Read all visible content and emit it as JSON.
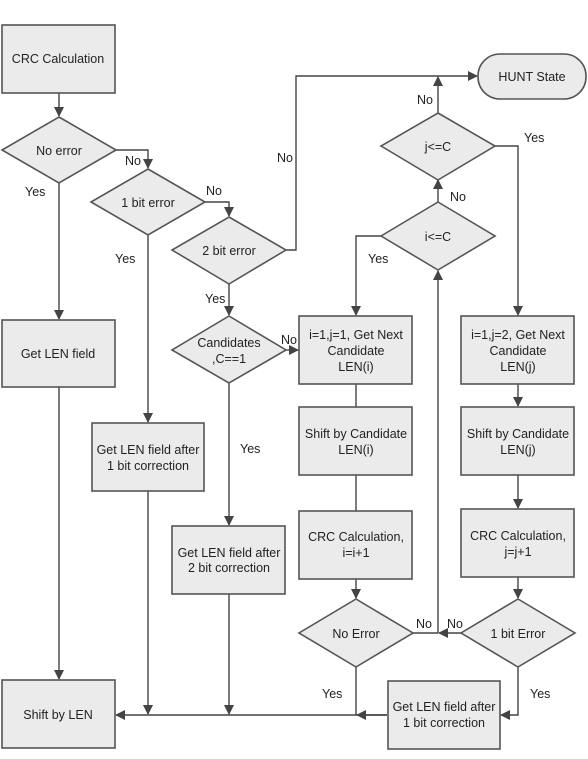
{
  "diagram": {
    "type": "flowchart",
    "nodes": {
      "crc_calc": {
        "shape": "process",
        "lines": [
          "CRC Calculation"
        ]
      },
      "no_error": {
        "shape": "decision",
        "lines": [
          "No error"
        ]
      },
      "one_bit_error": {
        "shape": "decision",
        "lines": [
          "1 bit error"
        ]
      },
      "two_bit_error": {
        "shape": "decision",
        "lines": [
          "2 bit error"
        ]
      },
      "candidates": {
        "shape": "decision",
        "lines": [
          "Candidates",
          ",C==1"
        ]
      },
      "get_len": {
        "shape": "process",
        "lines": [
          "Get LEN field"
        ]
      },
      "get_len_1bit": {
        "shape": "process",
        "lines": [
          "Get LEN field after",
          "1 bit correction"
        ]
      },
      "get_len_2bit": {
        "shape": "process",
        "lines": [
          "Get LEN field after",
          "2 bit correction"
        ]
      },
      "shift_by_len": {
        "shape": "process",
        "lines": [
          "Shift by LEN"
        ]
      },
      "hunt_state": {
        "shape": "terminal",
        "lines": [
          "HUNT State"
        ]
      },
      "j_le_c": {
        "shape": "decision",
        "lines": [
          "j<=C"
        ]
      },
      "i_le_c": {
        "shape": "decision",
        "lines": [
          "i<=C"
        ]
      },
      "init_i": {
        "shape": "process",
        "lines": [
          "i=1,j=1, Get Next",
          "Candidate",
          "LEN(i)"
        ]
      },
      "shift_cand_i": {
        "shape": "process",
        "lines": [
          "Shift by Candidate",
          "LEN(i)"
        ]
      },
      "crc_calc_i": {
        "shape": "process",
        "lines": [
          "CRC Calculation,",
          "i=i+1"
        ]
      },
      "no_error_i": {
        "shape": "decision",
        "lines": [
          "No Error"
        ]
      },
      "init_j": {
        "shape": "process",
        "lines": [
          "i=1,j=2, Get Next",
          "Candidate",
          "LEN(j)"
        ]
      },
      "shift_cand_j": {
        "shape": "process",
        "lines": [
          "Shift by Candidate",
          "LEN(j)"
        ]
      },
      "crc_calc_j": {
        "shape": "process",
        "lines": [
          "CRC Calculation,",
          "j=j+1"
        ]
      },
      "one_bit_error_j": {
        "shape": "decision",
        "lines": [
          "1 bit Error"
        ]
      },
      "get_len_1bit_j": {
        "shape": "process",
        "lines": [
          "Get LEN field after",
          "1 bit correction"
        ]
      }
    },
    "edges": [
      {
        "from": "crc_calc",
        "to": "no_error",
        "label": ""
      },
      {
        "from": "no_error",
        "to": "get_len",
        "label": "Yes"
      },
      {
        "from": "no_error",
        "to": "one_bit_error",
        "label": "No"
      },
      {
        "from": "one_bit_error",
        "to": "get_len_1bit",
        "label": "Yes"
      },
      {
        "from": "one_bit_error",
        "to": "two_bit_error",
        "label": "No"
      },
      {
        "from": "two_bit_error",
        "to": "hunt_state",
        "label": "No"
      },
      {
        "from": "two_bit_error",
        "to": "candidates",
        "label": "Yes"
      },
      {
        "from": "candidates",
        "to": "get_len_2bit",
        "label": "Yes"
      },
      {
        "from": "candidates",
        "to": "init_i",
        "label": "No"
      },
      {
        "from": "get_len",
        "to": "shift_by_len",
        "label": ""
      },
      {
        "from": "get_len_1bit",
        "to": "shift_by_len",
        "label": ""
      },
      {
        "from": "get_len_2bit",
        "to": "shift_by_len",
        "label": ""
      },
      {
        "from": "init_i",
        "to": "shift_cand_i",
        "label": ""
      },
      {
        "from": "shift_cand_i",
        "to": "crc_calc_i",
        "label": ""
      },
      {
        "from": "crc_calc_i",
        "to": "no_error_i",
        "label": ""
      },
      {
        "from": "no_error_i",
        "to": "shift_by_len",
        "label": "Yes"
      },
      {
        "from": "no_error_i",
        "to": "i_le_c",
        "label": "No"
      },
      {
        "from": "i_le_c",
        "to": "init_i",
        "label": "Yes"
      },
      {
        "from": "i_le_c",
        "to": "j_le_c",
        "label": "No"
      },
      {
        "from": "j_le_c",
        "to": "hunt_state",
        "label": "No"
      },
      {
        "from": "j_le_c",
        "to": "init_j",
        "label": "Yes"
      },
      {
        "from": "init_j",
        "to": "shift_cand_j",
        "label": ""
      },
      {
        "from": "shift_cand_j",
        "to": "crc_calc_j",
        "label": ""
      },
      {
        "from": "crc_calc_j",
        "to": "one_bit_error_j",
        "label": ""
      },
      {
        "from": "one_bit_error_j",
        "to": "get_len_1bit_j",
        "label": "Yes"
      },
      {
        "from": "one_bit_error_j",
        "to": "i_le_c",
        "label": "No"
      },
      {
        "from": "get_len_1bit_j",
        "to": "shift_by_len",
        "label": ""
      }
    ],
    "labels": {
      "yes": "Yes",
      "no": "No"
    }
  }
}
